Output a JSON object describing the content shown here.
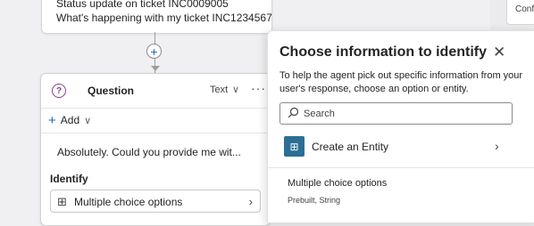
{
  "trigger": {
    "line1": "Status update on ticket INC0009005",
    "line2": "What's happening with my ticket INC1234567"
  },
  "add_node": {
    "symbol": "+"
  },
  "question_node": {
    "icon": "question-bubble-icon",
    "icon_symbol": "?",
    "title": "Question",
    "type_label": "Text",
    "type_chevron": "∨",
    "more": "···",
    "add_label": "Add",
    "add_symbol": "+",
    "add_chevron": "∨",
    "message": "Absolutely. Could you provide me wit...",
    "identify_label": "Identify",
    "identify_value": "Multiple choice options",
    "identify_icon": "grid-icon",
    "identify_icon_symbol": "⊞",
    "identify_chevron": "›"
  },
  "right_card": {
    "label": "Conf"
  },
  "panel": {
    "title": "Choose information to identify",
    "close_symbol": "✕",
    "description": "To help the agent pick out specific information from your user's response, choose an option or entity.",
    "search_placeholder": "Search",
    "create_entity_label": "Create an Entity",
    "create_entity_icon": "entity-icon",
    "create_entity_symbol": "⊞",
    "create_entity_chevron": "›",
    "option": {
      "title": "Multiple choice options",
      "subtitle": "Prebuilt, String"
    }
  },
  "colors": {
    "accent": "#2266c4",
    "question_icon": "#8a3d8f",
    "entity_tile": "#2b6f94",
    "canvas": "#f0f0f2"
  }
}
